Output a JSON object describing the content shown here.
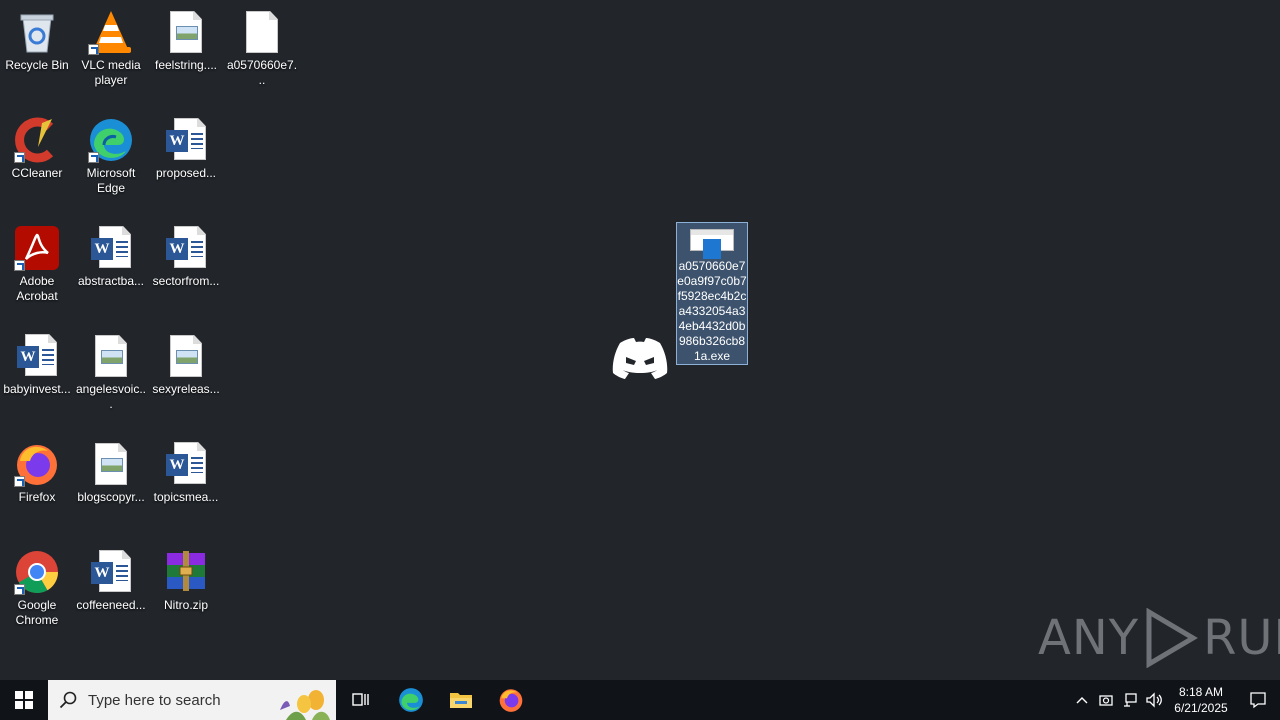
{
  "desktop_icons": {
    "recycle_bin": "Recycle Bin",
    "vlc": "VLC media player",
    "feelstring": "feelstring....",
    "a0570_short": "a0570660e7...",
    "ccleaner": "CCleaner",
    "edge": "Microsoft Edge",
    "proposed": "proposed...",
    "acrobat": "Adobe Acrobat",
    "abstractba": "abstractba...",
    "sectorfrom": "sectorfrom...",
    "babyinvest": "babyinvest...",
    "angelesvoic": "angelesvoic...",
    "sexyreleas": "sexyreleas...",
    "firefox": "Firefox",
    "blogscopyr": "blogscopyr...",
    "topicsmea": "topicsmea...",
    "chrome": "Google Chrome",
    "coffeeneed": "coffeeneed...",
    "nitro": "Nitro.zip"
  },
  "selected_file": {
    "label": "a0570660e7e0a9f97c0b7f5928ec4b2ca4332054a34eb4432d0b986b326cb81a.exe"
  },
  "watermark": {
    "text_left": "ANY",
    "text_right": "RUN"
  },
  "taskbar": {
    "search_placeholder": "Type here to search",
    "time": "8:18 AM",
    "date": "6/21/2025"
  },
  "colors": {
    "desktop_bg": "#22262b",
    "taskbar_bg": "#101418",
    "selection": "#608cbe"
  }
}
